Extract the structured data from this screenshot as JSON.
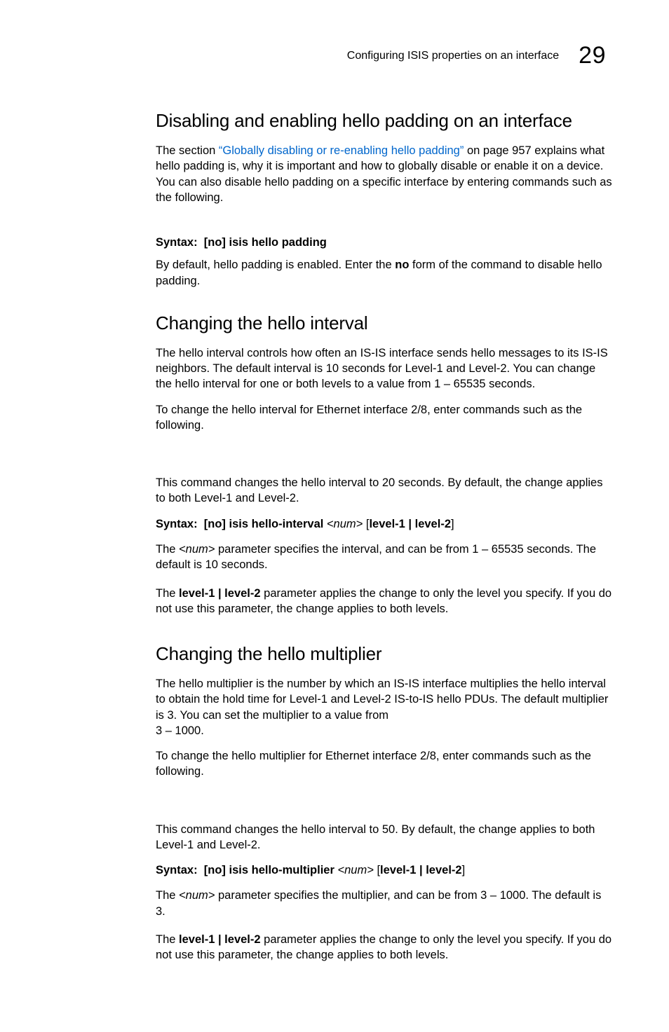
{
  "header": {
    "running_title": "Configuring ISIS properties on an interface",
    "chapter_number": "29"
  },
  "sections": [
    {
      "heading": "Disabling and enabling hello padding on an interface",
      "intro_pre": "The section ",
      "intro_link": "“Globally disabling or re-enabling hello padding”",
      "intro_post": " on page 957 explains what hello padding is, why it is important and how to globally disable or enable it on a device. You can also disable hello padding on a specific interface by entering commands such as the following.",
      "syntax": {
        "label": "Syntax:",
        "opt": "[no]",
        "cmd": "isis hello padding"
      },
      "note_pre": "By default, hello padding is enabled. Enter the ",
      "note_bold": "no",
      "note_post": " form of the command to disable hello padding."
    },
    {
      "heading": "Changing the hello interval",
      "p1": "The hello interval controls how often an IS-IS interface sends hello messages to its IS-IS neighbors. The default interval is 10 seconds for Level-1 and Level-2. You can change the hello interval for one or both levels to a value from 1 – 65535 seconds.",
      "p2": "To change the hello interval for Ethernet interface 2/8, enter commands such as the following.",
      "p3": "This command changes the hello interval to 20 seconds. By default, the change applies to both Level-1 and Level-2.",
      "syntax": {
        "label": "Syntax:",
        "opt": "[no]",
        "cmd": "isis hello-interval",
        "arg": "<num>",
        "tail_open": " [",
        "tail_bold": "level-1 | level-2",
        "tail_close": "]"
      },
      "p4_pre": "The ",
      "p4_arg": "<num>",
      "p4_post": " parameter specifies the interval, and can be from 1 – 65535 seconds. The default is 10 seconds.",
      "p5_pre": "The ",
      "p5_bold": "level-1 | level-2",
      "p5_post": " parameter applies the change to only the level you specify. If you do not use this parameter, the change applies to both levels."
    },
    {
      "heading": "Changing the hello multiplier",
      "p1": "The hello multiplier is the number by which an IS-IS interface multiplies the hello interval to obtain the hold time for Level-1 and Level-2 IS-to-IS hello PDUs. The default multiplier is 3. You can set the multiplier to a value from",
      "p1b": "3 – 1000.",
      "p2": "To change the hello multiplier for Ethernet interface 2/8, enter commands such as the following.",
      "p3": "This command changes the hello interval to 50. By default, the change applies to both Level-1 and Level-2.",
      "syntax": {
        "label": "Syntax:",
        "opt": "[no]",
        "cmd": "isis hello-multiplier",
        "arg": "<num>",
        "tail_open": " [",
        "tail_bold": "level-1 | level-2",
        "tail_close": "]"
      },
      "p4_pre": "The ",
      "p4_arg": "<num>",
      "p4_post": " parameter specifies the multiplier, and can be from 3 – 1000. The default is 3.",
      "p5_pre": "The ",
      "p5_bold": "level-1 | level-2",
      "p5_post": " parameter applies the change to only the level you specify. If you do not use this parameter, the change applies to both levels."
    }
  ]
}
